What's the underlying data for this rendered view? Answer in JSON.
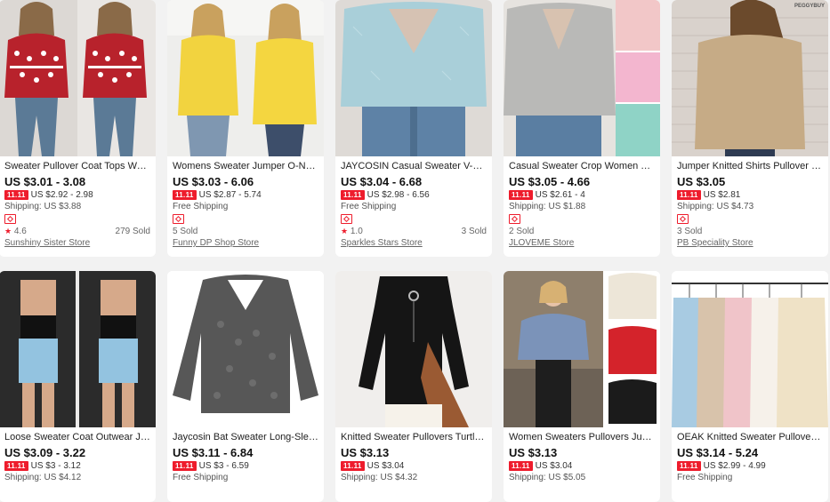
{
  "sale_badge": "11.11",
  "products": [
    {
      "title": "Sweater Pullover Coat Tops Wome...",
      "price": "US $3.01 - 3.08",
      "sale_price": "US $2.92 - 2.98",
      "shipping": "Shipping: US $3.88",
      "rating": "4.6",
      "sold": "279 Sold",
      "store": "Sunshiny Sister Store",
      "image": "red-white-nordic-sweater-photo"
    },
    {
      "title": "Womens Sweater Jumper O-Neck ...",
      "price": "US $3.03 - 6.06",
      "sale_price": "US $2.87 - 5.74",
      "shipping": "Free Shipping",
      "rating": "",
      "sold": "5 Sold",
      "store": "Funny DP Shop Store",
      "image": "yellow-sweater-photo"
    },
    {
      "title": "JAYCOSIN Casual Sweater V-Neck ...",
      "price": "US $3.04 - 6.68",
      "sale_price": "US $2.98 - 6.56",
      "shipping": "Free Shipping",
      "rating": "1.0",
      "sold": "3 Sold",
      "store": "Sparkles Stars Store",
      "image": "light-blue-fuzzy-crop-sweater-photo"
    },
    {
      "title": "Casual Sweater Crop Women Tops...",
      "price": "US $3.05 - 4.66",
      "sale_price": "US $2.61 - 4",
      "shipping": "Shipping: US $1.88",
      "rating": "",
      "sold": "2 Sold",
      "store": "JLOVEME Store",
      "image": "grey-fuzzy-crop-sweater-photo"
    },
    {
      "title": "Jumper Knitted Shirts Pullover Fe...",
      "price": "US $3.05",
      "sale_price": "US $2.81",
      "shipping": "Shipping: US $4.73",
      "rating": "",
      "sold": "3 Sold",
      "store": "PB Speciality Store",
      "image": "beige-off-shoulder-sweater-photo",
      "label": "PEGGYBUY"
    },
    {
      "title": "Loose Sweater Coat Outwear Jacke...",
      "price": "US $3.09 - 3.22",
      "sale_price": "US $3 - 3.12",
      "shipping": "Shipping: US $4.12",
      "image": "black-cardigan-photo"
    },
    {
      "title": "Jaycosin Bat Sweater Long-Sleeve ...",
      "price": "US $3.11 - 6.84",
      "sale_price": "US $3 - 6.59",
      "shipping": "Free Shipping",
      "image": "grey-knit-sweater-photo"
    },
    {
      "title": "Knitted Sweater Pullovers Turtlene...",
      "price": "US $3.13",
      "sale_price": "US $3.04",
      "shipping": "Shipping: US $4.32",
      "image": "black-turtleneck-photo"
    },
    {
      "title": "Women Sweaters Pullovers Jumpe...",
      "price": "US $3.13",
      "sale_price": "US $3.04",
      "shipping": "Shipping: US $5.05",
      "image": "wrap-sweater-colors-photo"
    },
    {
      "title": "OEAK Knitted Sweater Pullovers Ju...",
      "price": "US $3.14 - 5.24",
      "sale_price": "US $2.99 - 4.99",
      "shipping": "Free Shipping",
      "image": "pastel-sweaters-hanger-photo"
    }
  ]
}
